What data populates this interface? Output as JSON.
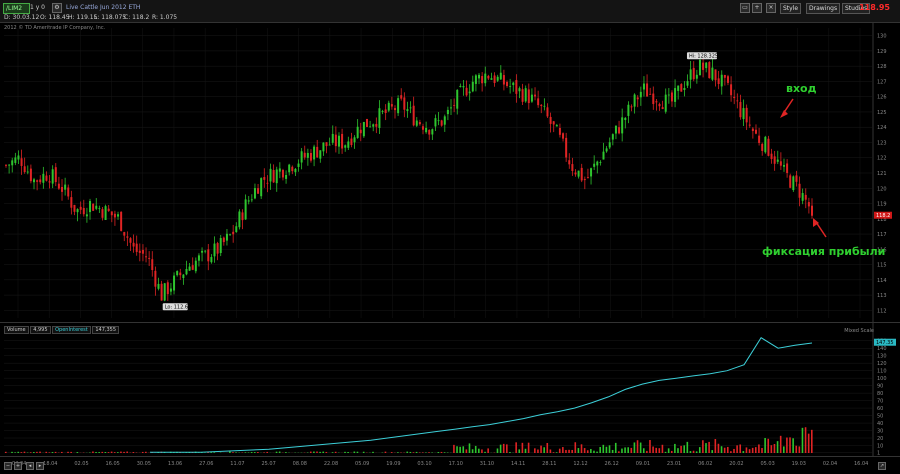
{
  "toolbar": {
    "symbol": "/LIM2",
    "interval": "1 y 0",
    "title": "Live Cattle Jun 2012 ETH",
    "quote": {
      "date": "D: 30.03.12",
      "open": "O: 118.45",
      "high": "H: 119.15",
      "low": "L: 118.075",
      "close": "C: 118.2",
      "range": "R: 1.075"
    },
    "buttons": {
      "style": "Style",
      "drawings": "Drawings",
      "studies": "Studies"
    },
    "last_price": "118.95"
  },
  "copyright": "2012 © TD Ameritrade IP Company, Inc.",
  "volume_header": {
    "volume_label": "Volume",
    "volume_value": "4,995",
    "oi_label": "OpenInterest",
    "oi_value": "147,355",
    "right_note": "Mixed Scale"
  },
  "price_tags": {
    "high": "Hi: 128.325",
    "low": "Lo: 112.6",
    "last": "118.2",
    "oi_last": "147.35"
  },
  "annotations": {
    "entry": "вход",
    "take_profit": "фиксация прибыли"
  },
  "chart_data": [
    {
      "type": "candlestick",
      "x": [
        "04.04",
        "18.04",
        "02.05",
        "16.05",
        "30.05",
        "13.06",
        "27.06",
        "11.07",
        "25.07",
        "08.08",
        "22.08",
        "05.09",
        "19.09",
        "03.10",
        "17.10",
        "31.10",
        "14.11",
        "28.11",
        "12.12",
        "26.12",
        "09.01",
        "23.01",
        "06.02",
        "20.02",
        "05.03",
        "19.03",
        "02.04",
        "16.04"
      ],
      "y_ticks": [
        112,
        113,
        114,
        115,
        116,
        117,
        118,
        119,
        120,
        121,
        122,
        123,
        124,
        125,
        126,
        127,
        128,
        129,
        130
      ],
      "ylim": [
        111.5,
        130.5
      ],
      "close_path": [
        121.5,
        122,
        120.5,
        121,
        120,
        118.5,
        119,
        118.5,
        118,
        116,
        115.5,
        113,
        114,
        115,
        115.5,
        116,
        117,
        119,
        120.5,
        121,
        121.5,
        122,
        122.5,
        123,
        123,
        124,
        124.5,
        125,
        125.5,
        124.5,
        124,
        124.5,
        126,
        127,
        127.5,
        127,
        126.5,
        126,
        125,
        123.5,
        121.5,
        120.5,
        122,
        123.5,
        125,
        126.5,
        126,
        125.5,
        127,
        128,
        127.5,
        126.5,
        125,
        123.5,
        122.5,
        121,
        120,
        118.5
      ],
      "high": 128.325,
      "low": 112.6,
      "last": 118.2
    },
    {
      "type": "line",
      "name": "OpenInterest",
      "y_ticks": [
        1,
        10,
        20,
        30,
        40,
        50,
        60,
        70,
        80,
        90,
        100,
        110,
        120,
        130,
        140,
        150
      ],
      "ylim": [
        0,
        155
      ],
      "values": [
        1,
        1,
        1,
        1,
        2,
        3,
        4,
        5,
        7,
        9,
        11,
        13,
        15,
        17,
        20,
        23,
        26,
        29,
        32,
        35,
        38,
        42,
        46,
        51,
        55,
        60,
        67,
        75,
        85,
        92,
        97,
        100,
        103,
        106,
        110,
        118,
        154,
        140,
        144,
        147
      ],
      "last": 147.35
    },
    {
      "type": "bar",
      "name": "Volume"
    }
  ],
  "colors": {
    "up": "#2ec52e",
    "down": "#e02424",
    "oi_line": "#3ccfd8",
    "annotation": "#2fd02f",
    "arrow": "#e02424"
  }
}
